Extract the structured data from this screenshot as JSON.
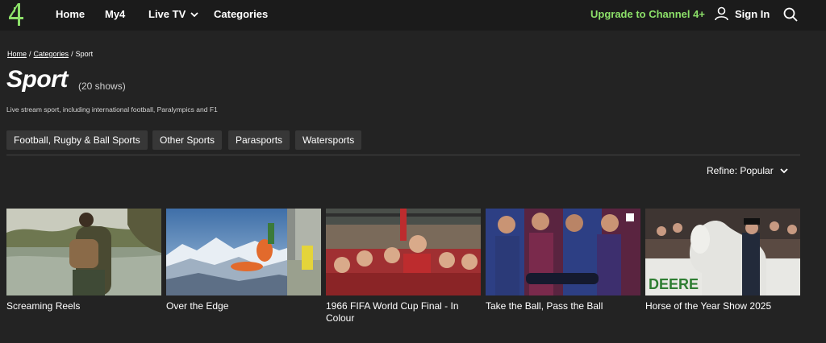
{
  "nav": {
    "logo": "channel-4-logo",
    "links": [
      "Home",
      "My4",
      "Live TV",
      "Categories"
    ],
    "upgrade": "Upgrade to Channel 4+",
    "signin": "Sign In",
    "accent": "#8ce069"
  },
  "breadcrumb": {
    "items": [
      "Home",
      "Categories",
      "Sport"
    ],
    "separator": "/"
  },
  "page": {
    "title": "Sport",
    "count": "(20 shows)",
    "description": "Live stream sport, including international football, Paralympics and F1"
  },
  "filters": [
    "Football, Rugby & Ball Sports",
    "Other Sports",
    "Parasports",
    "Watersports"
  ],
  "refine": {
    "label": "Refine: Popular"
  },
  "shows": [
    {
      "title": "Screaming Reels"
    },
    {
      "title": "Over the Edge"
    },
    {
      "title": "1966 FIFA World Cup Final - In Colour"
    },
    {
      "title": "Take the Ball, Pass the Ball"
    },
    {
      "title": "Horse of the Year Show 2025",
      "thumb_text": "DEERE"
    }
  ]
}
